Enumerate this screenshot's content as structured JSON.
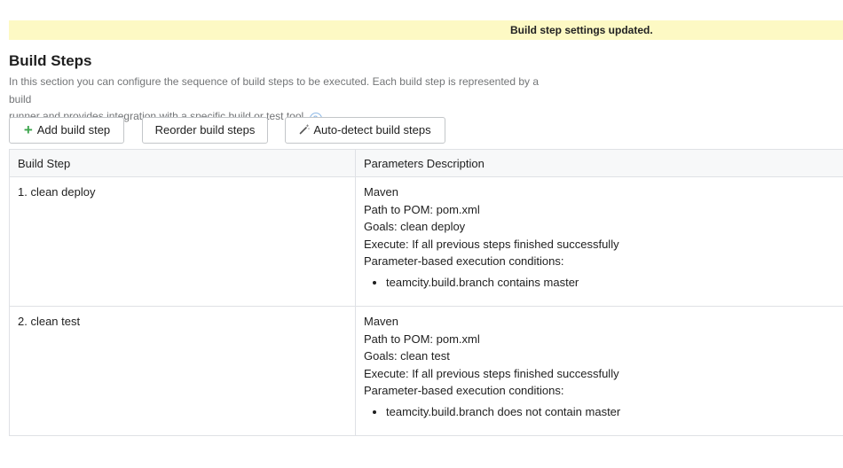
{
  "banner": {
    "message": "Build step settings updated."
  },
  "header": {
    "title": "Build Steps",
    "description_line1": "In this section you can configure the sequence of build steps to be executed. Each build step is represented by a build",
    "description_line2": "runner and provides integration with a specific build or test tool."
  },
  "toolbar": {
    "add_label": "Add build step",
    "reorder_label": "Reorder build steps",
    "autodetect_label": "Auto-detect build steps"
  },
  "table": {
    "columns": [
      "Build Step",
      "Parameters Description"
    ],
    "rows": [
      {
        "step": "1. clean deploy",
        "runner": "Maven",
        "pom": "Path to POM: pom.xml",
        "goals": "Goals: clean deploy",
        "execute": "Execute: If all previous steps finished successfully",
        "conditions_label": "Parameter-based execution conditions:",
        "conditions": [
          "teamcity.build.branch contains master"
        ]
      },
      {
        "step": "2. clean test",
        "runner": "Maven",
        "pom": "Path to POM: pom.xml",
        "goals": "Goals: clean test",
        "execute": "Execute: If all previous steps finished successfully",
        "conditions_label": "Parameter-based execution conditions:",
        "conditions": [
          "teamcity.build.branch does not contain master"
        ]
      }
    ]
  },
  "colors": {
    "banner_bg": "#fdf9c4",
    "accent_plus": "#3ea64e",
    "help_icon": "#8db9e6",
    "muted_text": "#737577",
    "border": "#dfe1e5"
  },
  "icons": [
    "plus-icon",
    "wand-icon",
    "help-icon"
  ]
}
